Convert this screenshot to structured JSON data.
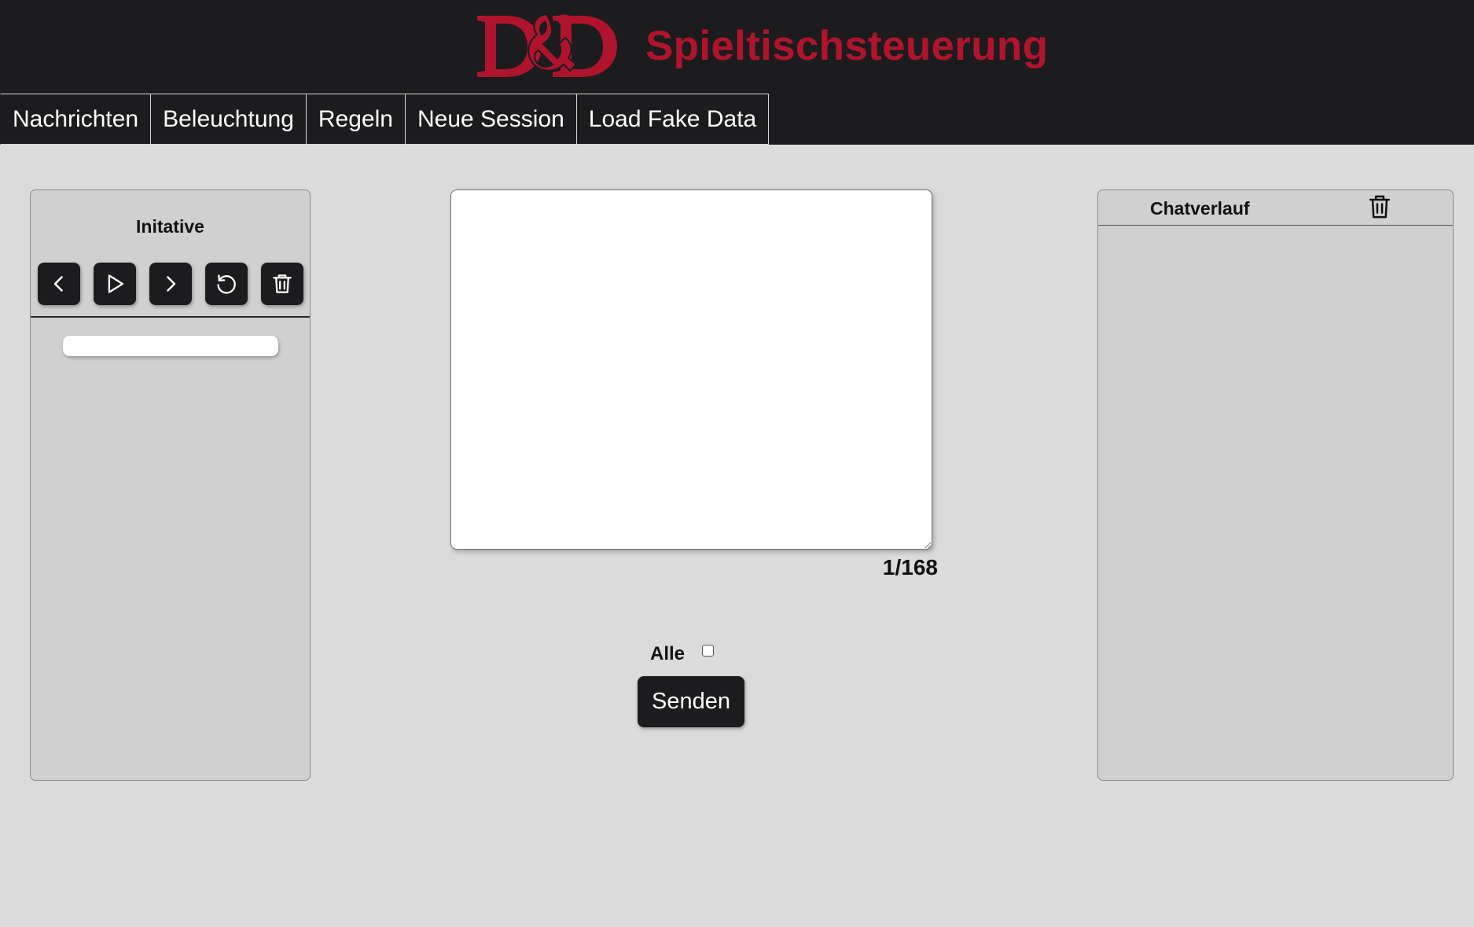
{
  "header": {
    "logo_text": "D&D",
    "title": "Spieltischsteuerung",
    "accent_color": "#b0142c",
    "background": "#1c1b1d"
  },
  "nav": {
    "items": [
      {
        "label": "Nachrichten"
      },
      {
        "label": "Beleuchtung"
      },
      {
        "label": "Regeln"
      },
      {
        "label": "Neue Session"
      },
      {
        "label": "Load Fake Data"
      }
    ]
  },
  "initiative": {
    "title": "Initative",
    "controls": [
      {
        "icon": "chevron-left-icon"
      },
      {
        "icon": "play-icon"
      },
      {
        "icon": "chevron-right-icon"
      },
      {
        "icon": "reset-icon"
      },
      {
        "icon": "trash-icon"
      }
    ],
    "entries": [
      ""
    ]
  },
  "message": {
    "value": "",
    "char_count": "1/168"
  },
  "send": {
    "alle_label": "Alle",
    "alle_checked": false,
    "button_label": "Senden"
  },
  "chat": {
    "title": "Chatverlauf",
    "clear_icon": "trash-icon",
    "messages": []
  }
}
